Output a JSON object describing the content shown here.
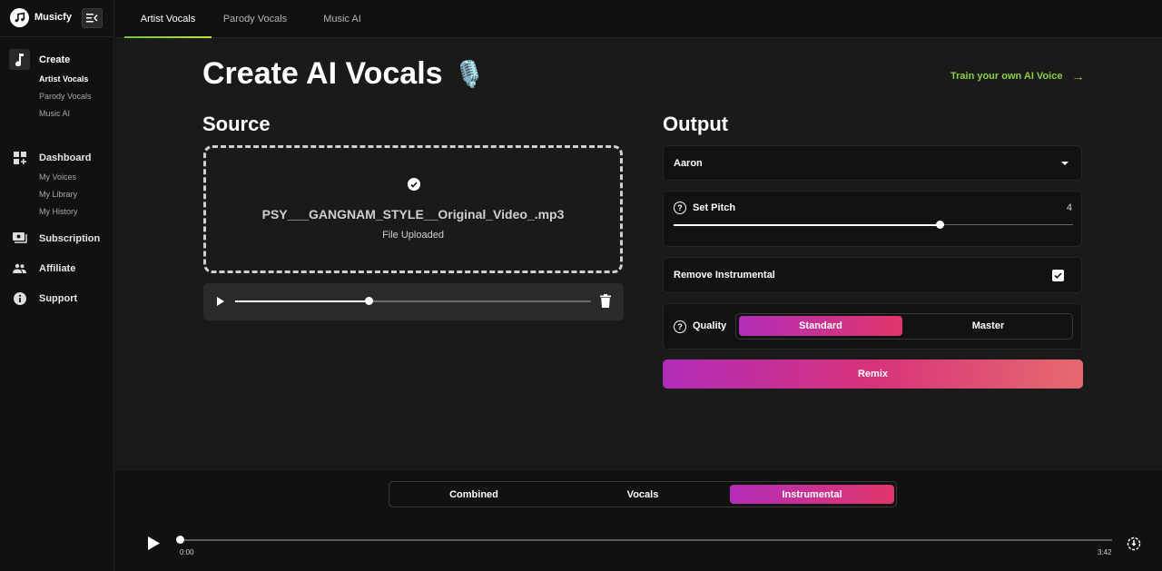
{
  "app": {
    "name": "Musicfy"
  },
  "sidebar": {
    "sections": [
      {
        "label": "Create",
        "icon": "music-note-icon",
        "active": true,
        "items": [
          {
            "label": "Artist Vocals",
            "active": true
          },
          {
            "label": "Parody Vocals",
            "active": false
          },
          {
            "label": "Music AI",
            "active": false
          }
        ]
      },
      {
        "label": "Dashboard",
        "icon": "dashboard-add-icon",
        "active": false,
        "items": [
          {
            "label": "My Voices",
            "active": false
          },
          {
            "label": "My Library",
            "active": false
          },
          {
            "label": "My History",
            "active": false
          }
        ]
      },
      {
        "label": "Subscription",
        "icon": "subscription-icon",
        "active": false,
        "items": []
      },
      {
        "label": "Affiliate",
        "icon": "people-icon",
        "active": false,
        "items": []
      },
      {
        "label": "Support",
        "icon": "info-icon",
        "active": false,
        "items": []
      }
    ]
  },
  "tabs": [
    {
      "label": "Artist Vocals",
      "active": true
    },
    {
      "label": "Parody Vocals",
      "active": false
    },
    {
      "label": "Music AI",
      "active": false
    }
  ],
  "main": {
    "title": "Create AI Vocals",
    "title_emoji": "🎙️",
    "train_link": "Train your own AI Voice",
    "source": {
      "heading": "Source",
      "file_name": "PSY___GANGNAM_STYLE__Original_Video_.mp3",
      "file_status": "File Uploaded",
      "preview_progress": 0.375
    },
    "output": {
      "heading": "Output",
      "voice": "Aaron",
      "pitch_label": "Set Pitch",
      "pitch_value": "4",
      "pitch_fraction": 0.667,
      "remove_instrumental_label": "Remove Instrumental",
      "remove_instrumental_checked": true,
      "quality_label": "Quality",
      "quality_options": [
        {
          "label": "Standard",
          "active": true
        },
        {
          "label": "Master",
          "active": false
        }
      ],
      "remix_label": "Remix"
    }
  },
  "player": {
    "stems": [
      {
        "label": "Combined",
        "active": false
      },
      {
        "label": "Vocals",
        "active": false
      },
      {
        "label": "Instrumental",
        "active": true
      }
    ],
    "current_time": "0:00",
    "duration": "3:42",
    "progress": 0
  },
  "colors": {
    "accent_green": "#8ad13e",
    "gradient_start": "#b02cb8",
    "gradient_end": "#e66a6e"
  }
}
